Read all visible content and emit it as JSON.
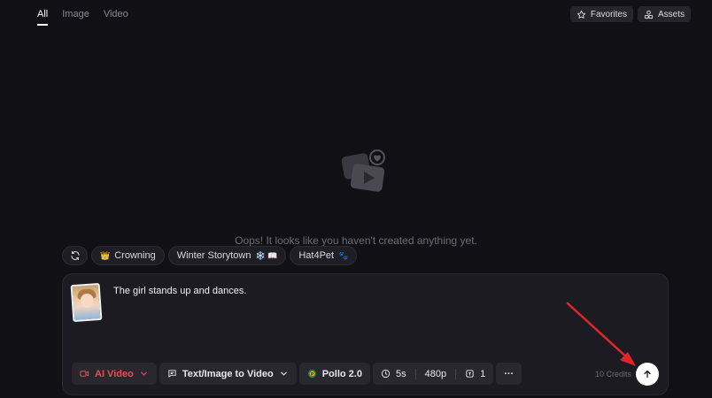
{
  "tabs": [
    {
      "label": "All",
      "active": true
    },
    {
      "label": "Image",
      "active": false
    },
    {
      "label": "Video",
      "active": false
    }
  ],
  "header": {
    "favorites_label": "Favorites",
    "assets_label": "Assets"
  },
  "empty_state": {
    "message": "Oops! It looks like you haven't created anything yet."
  },
  "chips": [
    {
      "label": "Crowning",
      "emoji": "👑",
      "emoji_position": "before"
    },
    {
      "label": "Winter Storytown",
      "emoji": "❄️ 📖",
      "emoji_position": "after"
    },
    {
      "label": "Hat4Pet",
      "emoji": "🐾",
      "emoji_position": "after"
    }
  ],
  "composer": {
    "prompt_text": "The girl stands up and dances.",
    "credits_text": "10 Credits"
  },
  "toolbar": {
    "mode_label": "AI Video",
    "task_label": "Text/Image to Video",
    "model_label": "Pollo 2.0",
    "duration_label": "5s",
    "resolution_label": "480p",
    "count_label": "1",
    "more_label": "···"
  },
  "colors": {
    "background": "#111015",
    "accent_red": "#ef4b56",
    "annotation_arrow": "#e0262a"
  },
  "icons": {
    "refresh": "refresh-icon",
    "star": "star-icon",
    "assets": "assets-icon",
    "video_camera": "video-camera-icon",
    "chat_image": "chat-image-icon",
    "pollo_logo": "pollo-logo-icon",
    "clock": "clock-icon",
    "counter": "counter-icon",
    "send": "arrow-up-icon"
  }
}
